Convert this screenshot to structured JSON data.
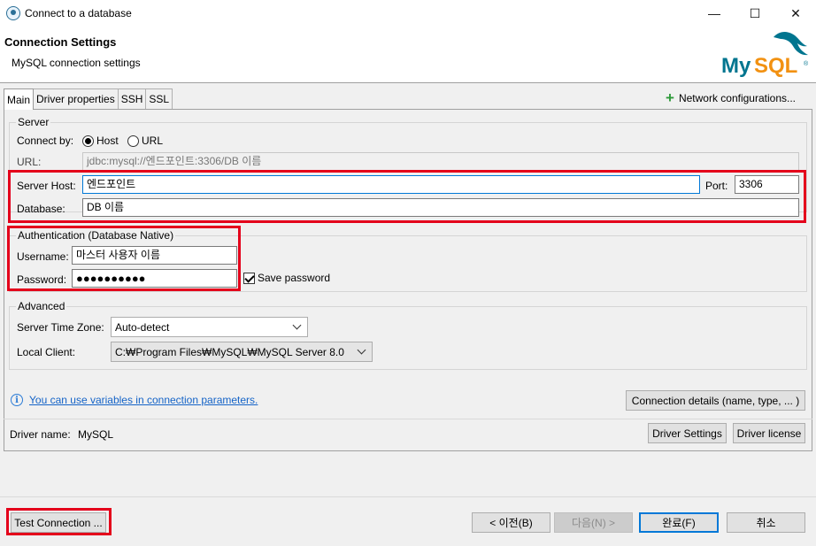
{
  "window": {
    "title": "Connect to a database",
    "minimize": "—",
    "maximize": "☐",
    "close": "✕"
  },
  "header": {
    "title": "Connection Settings",
    "subtitle": "MySQL connection settings",
    "logo_text": "MySQL",
    "logo_mark": "®"
  },
  "tabs": [
    {
      "label": "Main"
    },
    {
      "label": "Driver properties"
    },
    {
      "label": "SSH"
    },
    {
      "label": "SSL"
    }
  ],
  "network_config": {
    "label": "Network configurations..."
  },
  "server": {
    "legend": "Server",
    "connect_by_label": "Connect by:",
    "options": [
      {
        "label": "Host",
        "selected": true
      },
      {
        "label": "URL",
        "selected": false
      }
    ],
    "url_label": "URL:",
    "url_value": "jdbc:mysql://엔드포인트:3306/DB 이름",
    "host_label": "Server Host:",
    "host_value": "엔드포인트",
    "port_label": "Port:",
    "port_value": "3306",
    "database_label": "Database:",
    "database_value": "DB 이름"
  },
  "auth": {
    "legend": "Authentication (Database Native)",
    "username_label": "Username:",
    "username_value": "마스터 사용자 이름",
    "password_label": "Password:",
    "password_value": "●●●●●●●●●●",
    "save_password_label": "Save password",
    "save_password_checked": true
  },
  "advanced": {
    "legend": "Advanced",
    "timezone_label": "Server Time Zone:",
    "timezone_value": "Auto-detect",
    "local_client_label": "Local Client:",
    "local_client_value": "C:₩Program Files₩MySQL₩MySQL Server 8.0"
  },
  "info": {
    "link_text": "You can use variables in connection parameters.",
    "icon": "info-icon"
  },
  "connection_details_button": "Connection details (name, type, ... )",
  "driver": {
    "label": "Driver name:",
    "value": "MySQL",
    "settings_button": "Driver Settings",
    "license_button": "Driver license"
  },
  "footer": {
    "test_button": "Test Connection ...",
    "back_button": "< 이전(B)",
    "next_button": "다음(N) >",
    "finish_button": "완료(F)",
    "cancel_button": "취소"
  },
  "colors": {
    "highlight": "#e4001b",
    "link": "#1463c7",
    "accent": "#0078d7",
    "mysql_blue": "#00758f",
    "mysql_orange": "#f29111"
  }
}
